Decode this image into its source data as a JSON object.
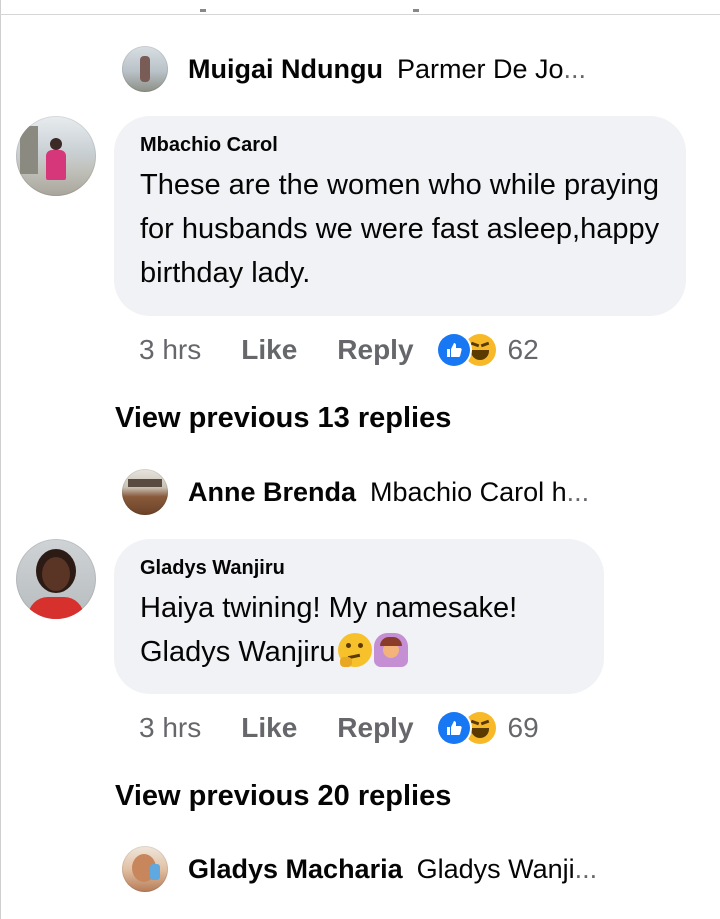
{
  "colors": {
    "bubble_bg": "#f0f2f5",
    "secondary_text": "#65676b",
    "like_blue": "#1877f2",
    "haha_yellow": "#f7b928"
  },
  "thread1": {
    "prev_reply": {
      "name": "Muigai Ndungu",
      "preview": "Parmer De Jo",
      "ellipsis": "..."
    },
    "comment": {
      "author": "Mbachio Carol",
      "text": "These are the women who while praying for husbands we were fast asleep,happy birthday lady.",
      "time": "3 hrs",
      "like": "Like",
      "reply": "Reply",
      "reactions": {
        "icons": [
          "like-icon",
          "haha-icon"
        ],
        "count": "62"
      }
    },
    "view_previous": "View previous 13 replies"
  },
  "thread2": {
    "prev_reply": {
      "name": "Anne Brenda",
      "preview": "Mbachio Carol h",
      "ellipsis": "..."
    },
    "comment": {
      "author": "Gladys Wanjiru",
      "text_line1": "Haiya twining! My namesake!",
      "text_line2": "Gladys Wanjiru",
      "emojis": [
        "thinking-face-emoji",
        "person-gesturing-ok-emoji"
      ],
      "time": "3 hrs",
      "like": "Like",
      "reply": "Reply",
      "reactions": {
        "icons": [
          "like-icon",
          "haha-icon"
        ],
        "count": "69"
      }
    },
    "view_previous": "View previous 20 replies"
  },
  "thread3": {
    "prev_reply": {
      "name": "Gladys Macharia",
      "preview": "Gladys Wanji",
      "ellipsis": "..."
    }
  }
}
